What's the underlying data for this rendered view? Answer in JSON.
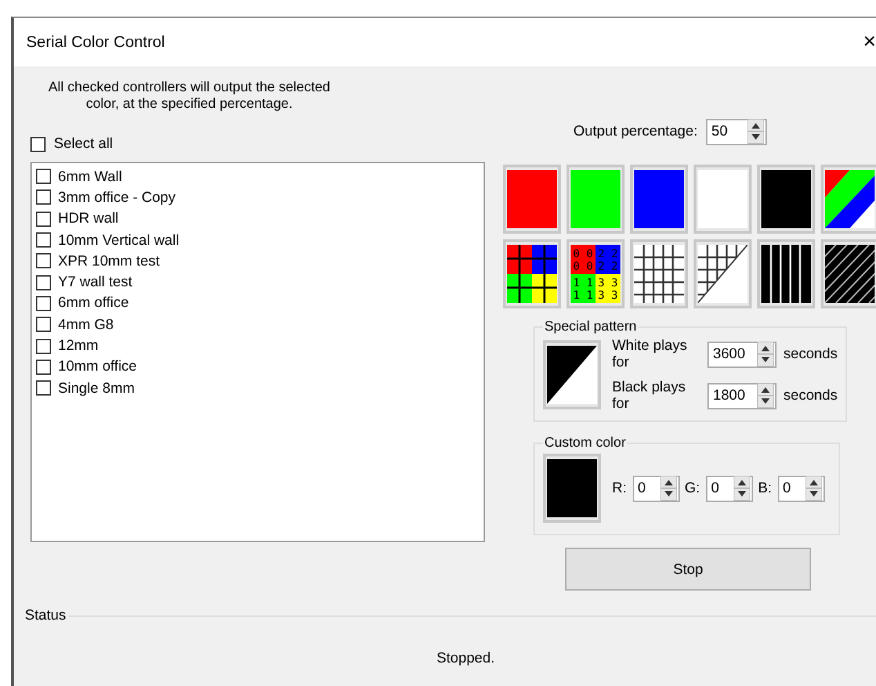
{
  "window": {
    "title": "Serial Color Control",
    "close": "×"
  },
  "instructions": "All checked controllers will output the selected\ncolor, at the specified percentage.",
  "select_all": {
    "label": "Select all",
    "checked": false
  },
  "controllers": [
    {
      "label": "6mm Wall",
      "checked": false
    },
    {
      "label": "3mm office - Copy",
      "checked": false
    },
    {
      "label": "HDR wall",
      "checked": false
    },
    {
      "label": "10mm Vertical wall",
      "checked": false
    },
    {
      "label": "XPR 10mm  test",
      "checked": false
    },
    {
      "label": "Y7 wall test",
      "checked": false
    },
    {
      "label": "6mm office",
      "checked": false
    },
    {
      "label": "4mm G8",
      "checked": false
    },
    {
      "label": "12mm",
      "checked": false
    },
    {
      "label": "10mm office",
      "checked": false
    },
    {
      "label": "Single 8mm",
      "checked": false
    }
  ],
  "output_percentage": {
    "label": "Output percentage:",
    "value": "50"
  },
  "patterns": [
    {
      "kind": "solid",
      "color": "#ff0000"
    },
    {
      "kind": "solid",
      "color": "#00ff00"
    },
    {
      "kind": "solid",
      "color": "#0000ff"
    },
    {
      "kind": "solid",
      "color": "#ffffff"
    },
    {
      "kind": "solid",
      "color": "#000000"
    },
    {
      "kind": "diagonal"
    },
    {
      "kind": "quad"
    },
    {
      "kind": "numbered",
      "quadrants": [
        [
          "0 0",
          "0 0"
        ],
        [
          "2 2",
          "2 2"
        ],
        [
          "1 1",
          "1 1"
        ],
        [
          "3 3",
          "3 3"
        ]
      ]
    },
    {
      "kind": "grid"
    },
    {
      "kind": "half-grid"
    },
    {
      "kind": "stripes"
    },
    {
      "kind": "hatch"
    }
  ],
  "special_pattern": {
    "title": "Special pattern",
    "rows": [
      {
        "label": "White plays for",
        "value": "3600",
        "unit": "seconds"
      },
      {
        "label": "Black plays for",
        "value": "1800",
        "unit": "seconds"
      }
    ]
  },
  "custom_color": {
    "title": "Custom color",
    "color": "#000000",
    "channels": [
      {
        "label": "R:",
        "value": "0"
      },
      {
        "label": "G:",
        "value": "0"
      },
      {
        "label": "B:",
        "value": "0"
      }
    ]
  },
  "stop_button": "Stop",
  "status": {
    "title": "Status",
    "text": "Stopped."
  }
}
